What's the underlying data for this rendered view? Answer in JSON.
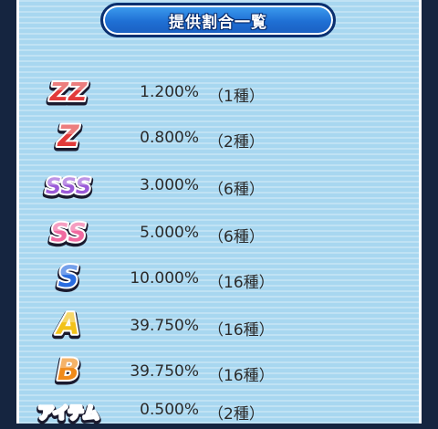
{
  "title": "提供割合一覧",
  "rows": [
    {
      "rank": "ZZ",
      "rate": "1.200%",
      "count": "（1種）",
      "color": "#e23a3a",
      "text": "ZZ"
    },
    {
      "rank": "Z",
      "rate": "0.800%",
      "count": "（2種）",
      "color": "#e23a3a",
      "text": "Z"
    },
    {
      "rank": "SSS",
      "rate": "3.000%",
      "count": "（6種）",
      "color": "#9b5ad8",
      "text": "SSS"
    },
    {
      "rank": "SS",
      "rate": "5.000%",
      "count": "（6種）",
      "color": "#f06aa0",
      "text": "SS"
    },
    {
      "rank": "S",
      "rate": "10.000%",
      "count": "（16種）",
      "color": "#2a6de0",
      "text": "S"
    },
    {
      "rank": "A",
      "rate": "39.750%",
      "count": "（16種）",
      "color": "#f2c21a",
      "text": "A"
    },
    {
      "rank": "B",
      "rate": "39.750%",
      "count": "（16種）",
      "color": "#f08a1a",
      "text": "B"
    },
    {
      "rank": "アイテム",
      "rate": "0.500%",
      "count": "（2種）",
      "color": "#ffffff",
      "text": "アイテム"
    }
  ]
}
